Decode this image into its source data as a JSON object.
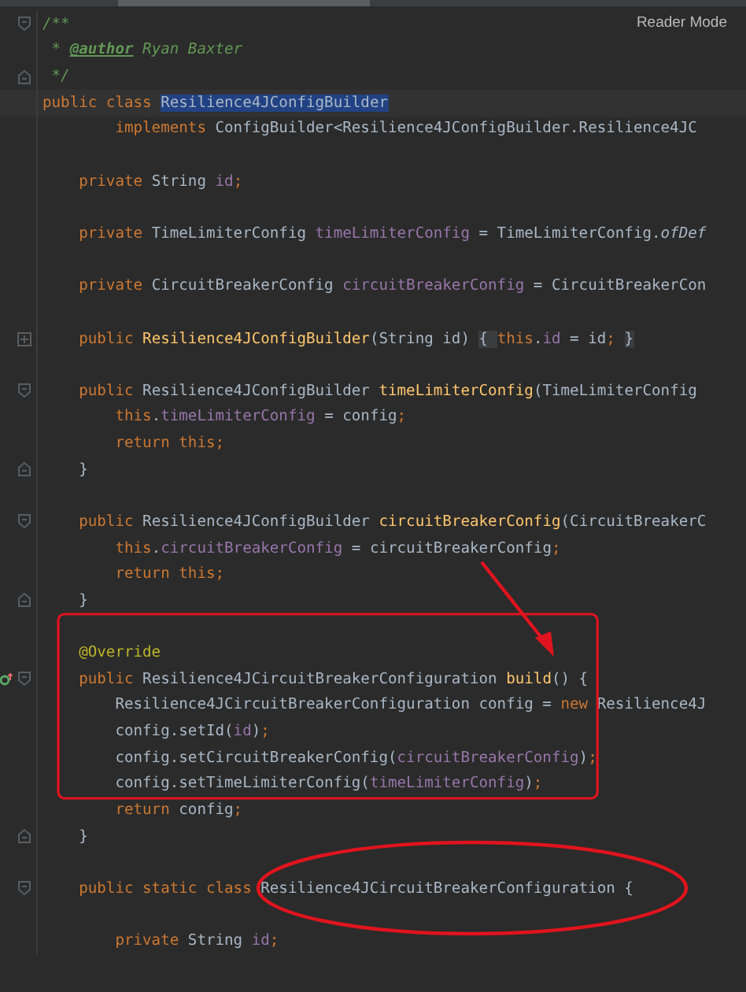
{
  "toolbar": {
    "reader_mode": "Reader Mode"
  },
  "lines": [
    {
      "kind": "fold-start",
      "tokens": [
        {
          "kind": "comment",
          "text": "/**"
        }
      ]
    },
    {
      "kind": "code",
      "tokens": [
        {
          "kind": "comment",
          "text": " * "
        },
        {
          "kind": "doctag",
          "text": "@author"
        },
        {
          "kind": "comment",
          "text": " Ryan Baxter"
        }
      ]
    },
    {
      "kind": "fold-end",
      "tokens": [
        {
          "kind": "comment",
          "text": " */"
        }
      ]
    },
    {
      "kind": "code",
      "current": true,
      "tokens": [
        {
          "kind": "keyword",
          "text": "public class "
        },
        {
          "kind": "selection",
          "text": "Resilience4JConfigBuilder"
        }
      ]
    },
    {
      "kind": "code",
      "tokens": [
        {
          "kind": "keyword",
          "text": "        implements "
        },
        {
          "kind": "plain",
          "text": "ConfigBuilder<Resilience4JConfigBuilder.Resilience4JC"
        }
      ]
    },
    {
      "kind": "blank"
    },
    {
      "kind": "code",
      "tokens": [
        {
          "kind": "keyword",
          "text": "    private "
        },
        {
          "kind": "plain",
          "text": "String "
        },
        {
          "kind": "field",
          "text": "id"
        },
        {
          "kind": "keyword",
          "text": ";"
        }
      ]
    },
    {
      "kind": "blank"
    },
    {
      "kind": "code",
      "tokens": [
        {
          "kind": "keyword",
          "text": "    private "
        },
        {
          "kind": "plain",
          "text": "TimeLimiterConfig "
        },
        {
          "kind": "field",
          "text": "timeLimiterConfig"
        },
        {
          "kind": "plain",
          "text": " = TimeLimiterConfig."
        },
        {
          "kind": "static",
          "text": "ofDef"
        }
      ]
    },
    {
      "kind": "blank"
    },
    {
      "kind": "code",
      "tokens": [
        {
          "kind": "keyword",
          "text": "    private "
        },
        {
          "kind": "plain",
          "text": "CircuitBreakerConfig "
        },
        {
          "kind": "field",
          "text": "circuitBreakerConfig"
        },
        {
          "kind": "plain",
          "text": " = CircuitBreakerCon"
        }
      ]
    },
    {
      "kind": "blank"
    },
    {
      "kind": "folded",
      "tokens": [
        {
          "kind": "keyword",
          "text": "    public "
        },
        {
          "kind": "method",
          "text": "Resilience4JConfigBuilder"
        },
        {
          "kind": "plain",
          "text": "(String id) "
        },
        {
          "kind": "chip",
          "text": "{ "
        },
        {
          "kind": "keyword",
          "text": "this"
        },
        {
          "kind": "plain",
          "text": "."
        },
        {
          "kind": "field",
          "text": "id"
        },
        {
          "kind": "plain",
          "text": " = id"
        },
        {
          "kind": "keyword",
          "text": "; "
        },
        {
          "kind": "chip",
          "text": "}"
        }
      ]
    },
    {
      "kind": "blank"
    },
    {
      "kind": "fold-start",
      "tokens": [
        {
          "kind": "keyword",
          "text": "    public "
        },
        {
          "kind": "plain",
          "text": "Resilience4JConfigBuilder "
        },
        {
          "kind": "method",
          "text": "timeLimiterConfig"
        },
        {
          "kind": "plain",
          "text": "(TimeLimiterConfig"
        }
      ]
    },
    {
      "kind": "code",
      "tokens": [
        {
          "kind": "keyword",
          "text": "        this"
        },
        {
          "kind": "plain",
          "text": "."
        },
        {
          "kind": "field",
          "text": "timeLimiterConfig"
        },
        {
          "kind": "plain",
          "text": " = config"
        },
        {
          "kind": "keyword",
          "text": ";"
        }
      ]
    },
    {
      "kind": "code",
      "tokens": [
        {
          "kind": "keyword",
          "text": "        return this;"
        }
      ]
    },
    {
      "kind": "fold-end",
      "tokens": [
        {
          "kind": "plain",
          "text": "    }"
        }
      ]
    },
    {
      "kind": "blank"
    },
    {
      "kind": "fold-start",
      "tokens": [
        {
          "kind": "keyword",
          "text": "    public "
        },
        {
          "kind": "plain",
          "text": "Resilience4JConfigBuilder "
        },
        {
          "kind": "method",
          "text": "circuitBreakerConfig"
        },
        {
          "kind": "plain",
          "text": "(CircuitBreakerC"
        }
      ]
    },
    {
      "kind": "code",
      "tokens": [
        {
          "kind": "keyword",
          "text": "        this"
        },
        {
          "kind": "plain",
          "text": "."
        },
        {
          "kind": "field",
          "text": "circuitBreakerConfig"
        },
        {
          "kind": "plain",
          "text": " = circuitBreakerConfig"
        },
        {
          "kind": "keyword",
          "text": ";"
        }
      ]
    },
    {
      "kind": "code",
      "tokens": [
        {
          "kind": "keyword",
          "text": "        return this;"
        }
      ]
    },
    {
      "kind": "fold-end",
      "tokens": [
        {
          "kind": "plain",
          "text": "    }"
        }
      ]
    },
    {
      "kind": "blank"
    },
    {
      "kind": "code",
      "tokens": [
        {
          "kind": "annotation",
          "text": "    @Override"
        }
      ]
    },
    {
      "kind": "fold-start",
      "override": true,
      "tokens": [
        {
          "kind": "keyword",
          "text": "    public "
        },
        {
          "kind": "plain",
          "text": "Resilience4JCircuitBreakerConfiguration "
        },
        {
          "kind": "method",
          "text": "build"
        },
        {
          "kind": "plain",
          "text": "() {"
        }
      ]
    },
    {
      "kind": "code",
      "tokens": [
        {
          "kind": "plain",
          "text": "        Resilience4JCircuitBreakerConfiguration config = "
        },
        {
          "kind": "keyword",
          "text": "new "
        },
        {
          "kind": "plain",
          "text": "Resilience4J"
        }
      ]
    },
    {
      "kind": "code",
      "tokens": [
        {
          "kind": "plain",
          "text": "        config.setId("
        },
        {
          "kind": "field",
          "text": "id"
        },
        {
          "kind": "plain",
          "text": ")"
        },
        {
          "kind": "keyword",
          "text": ";"
        }
      ]
    },
    {
      "kind": "code",
      "tokens": [
        {
          "kind": "plain",
          "text": "        config.setCircuitBreakerConfig("
        },
        {
          "kind": "field",
          "text": "circuitBreakerConfig"
        },
        {
          "kind": "plain",
          "text": ")"
        },
        {
          "kind": "keyword",
          "text": ";"
        }
      ]
    },
    {
      "kind": "code",
      "tokens": [
        {
          "kind": "plain",
          "text": "        config.setTimeLimiterConfig("
        },
        {
          "kind": "field",
          "text": "timeLimiterConfig"
        },
        {
          "kind": "plain",
          "text": ")"
        },
        {
          "kind": "keyword",
          "text": ";"
        }
      ]
    },
    {
      "kind": "code",
      "tokens": [
        {
          "kind": "keyword",
          "text": "        return "
        },
        {
          "kind": "plain",
          "text": "config"
        },
        {
          "kind": "keyword",
          "text": ";"
        }
      ]
    },
    {
      "kind": "fold-end",
      "tokens": [
        {
          "kind": "plain",
          "text": "    }"
        }
      ]
    },
    {
      "kind": "blank"
    },
    {
      "kind": "fold-start",
      "tokens": [
        {
          "kind": "keyword",
          "text": "    public static class "
        },
        {
          "kind": "plain",
          "text": "Resilience4JCircuitBreakerConfiguration {"
        }
      ]
    },
    {
      "kind": "blank"
    },
    {
      "kind": "code",
      "tokens": [
        {
          "kind": "keyword",
          "text": "        private "
        },
        {
          "kind": "plain",
          "text": "String "
        },
        {
          "kind": "field",
          "text": "id"
        },
        {
          "kind": "keyword",
          "text": ";"
        }
      ]
    }
  ],
  "annotations": [
    {
      "kind": "rectangle"
    },
    {
      "kind": "arrow"
    },
    {
      "kind": "ellipse"
    }
  ]
}
